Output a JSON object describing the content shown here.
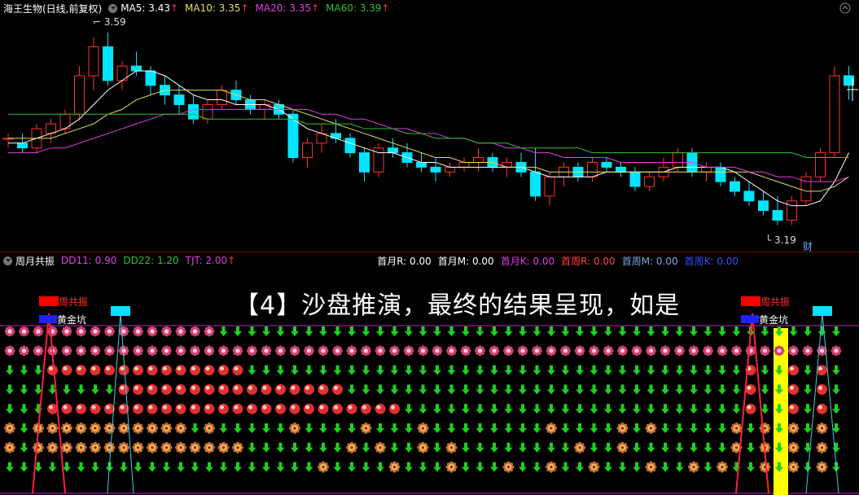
{
  "price_header": {
    "title": "海王生物(日线,前复权)",
    "ma5": "MA5: 3.43",
    "ma10": "MA10: 3.35",
    "ma20": "MA20: 3.35",
    "ma60": "MA60: 3.39",
    "arrow": "↑"
  },
  "price_annot": {
    "high": "3.59",
    "low": "3.19",
    "cai": "财"
  },
  "osc_header": {
    "title": "周月共振",
    "dd11": "DD11: 0.90",
    "dd22": "DD22: 1.20",
    "tjt": "TJT: 2.00",
    "arrow": "↑",
    "r1": "首月R: 0.00",
    "r2": "首月M: 0.00",
    "r3": "首月K: 0.00",
    "r4": "首周R: 0.00",
    "r5": "首周M: 0.00",
    "r6": "首周K: 0.00"
  },
  "overlay": {
    "caption": "【4】沙盘推演，最终的结果呈现，如是"
  },
  "markers": {
    "zhou": "周共振",
    "huang": "黄金坑"
  },
  "colors": {
    "up": "#ff3030",
    "down": "#00e5ff",
    "ma5": "#ffffff",
    "ma10": "#e0e060",
    "ma20": "#e040e0",
    "ma60": "#30c030"
  },
  "chart_data": {
    "type": "candlestick",
    "ylim": [
      3.15,
      3.62
    ],
    "ohlc": [
      [
        3.37,
        3.38,
        3.35,
        3.37
      ],
      [
        3.36,
        3.38,
        3.34,
        3.35
      ],
      [
        3.35,
        3.4,
        3.34,
        3.39
      ],
      [
        3.38,
        3.41,
        3.36,
        3.4
      ],
      [
        3.39,
        3.43,
        3.38,
        3.42
      ],
      [
        3.42,
        3.52,
        3.41,
        3.5
      ],
      [
        3.5,
        3.58,
        3.47,
        3.56
      ],
      [
        3.56,
        3.59,
        3.48,
        3.49
      ],
      [
        3.49,
        3.53,
        3.47,
        3.52
      ],
      [
        3.52,
        3.55,
        3.5,
        3.51
      ],
      [
        3.51,
        3.52,
        3.46,
        3.48
      ],
      [
        3.48,
        3.5,
        3.44,
        3.46
      ],
      [
        3.46,
        3.48,
        3.42,
        3.44
      ],
      [
        3.44,
        3.46,
        3.4,
        3.41
      ],
      [
        3.41,
        3.45,
        3.4,
        3.44
      ],
      [
        3.44,
        3.48,
        3.43,
        3.47
      ],
      [
        3.47,
        3.49,
        3.44,
        3.45
      ],
      [
        3.45,
        3.46,
        3.42,
        3.43
      ],
      [
        3.43,
        3.45,
        3.41,
        3.44
      ],
      [
        3.44,
        3.45,
        3.41,
        3.42
      ],
      [
        3.42,
        3.43,
        3.32,
        3.33
      ],
      [
        3.33,
        3.37,
        3.31,
        3.36
      ],
      [
        3.36,
        3.4,
        3.34,
        3.38
      ],
      [
        3.38,
        3.41,
        3.36,
        3.37
      ],
      [
        3.37,
        3.38,
        3.33,
        3.34
      ],
      [
        3.34,
        3.35,
        3.28,
        3.3
      ],
      [
        3.3,
        3.36,
        3.29,
        3.35
      ],
      [
        3.35,
        3.37,
        3.33,
        3.34
      ],
      [
        3.34,
        3.36,
        3.31,
        3.32
      ],
      [
        3.32,
        3.34,
        3.3,
        3.31
      ],
      [
        3.31,
        3.33,
        3.28,
        3.3
      ],
      [
        3.3,
        3.32,
        3.29,
        3.31
      ],
      [
        3.31,
        3.33,
        3.3,
        3.32
      ],
      [
        3.32,
        3.35,
        3.3,
        3.33
      ],
      [
        3.33,
        3.34,
        3.3,
        3.31
      ],
      [
        3.31,
        3.33,
        3.29,
        3.32
      ],
      [
        3.32,
        3.34,
        3.29,
        3.3
      ],
      [
        3.3,
        3.35,
        3.24,
        3.25
      ],
      [
        3.25,
        3.3,
        3.23,
        3.29
      ],
      [
        3.29,
        3.32,
        3.27,
        3.31
      ],
      [
        3.31,
        3.32,
        3.28,
        3.29
      ],
      [
        3.29,
        3.33,
        3.28,
        3.32
      ],
      [
        3.32,
        3.33,
        3.3,
        3.31
      ],
      [
        3.31,
        3.32,
        3.29,
        3.3
      ],
      [
        3.3,
        3.31,
        3.26,
        3.27
      ],
      [
        3.27,
        3.3,
        3.26,
        3.29
      ],
      [
        3.29,
        3.33,
        3.28,
        3.31
      ],
      [
        3.31,
        3.35,
        3.3,
        3.34
      ],
      [
        3.34,
        3.35,
        3.29,
        3.3
      ],
      [
        3.3,
        3.32,
        3.28,
        3.31
      ],
      [
        3.31,
        3.32,
        3.27,
        3.28
      ],
      [
        3.28,
        3.29,
        3.25,
        3.26
      ],
      [
        3.26,
        3.28,
        3.23,
        3.24
      ],
      [
        3.24,
        3.26,
        3.21,
        3.22
      ],
      [
        3.22,
        3.25,
        3.19,
        3.2
      ],
      [
        3.2,
        3.25,
        3.19,
        3.24
      ],
      [
        3.24,
        3.3,
        3.23,
        3.29
      ],
      [
        3.29,
        3.35,
        3.28,
        3.34
      ],
      [
        3.34,
        3.52,
        3.33,
        3.5
      ],
      [
        3.5,
        3.52,
        3.45,
        3.48
      ]
    ],
    "ma5": [
      3.36,
      3.36,
      3.37,
      3.38,
      3.39,
      3.41,
      3.44,
      3.47,
      3.49,
      3.51,
      3.51,
      3.5,
      3.48,
      3.46,
      3.45,
      3.45,
      3.44,
      3.44,
      3.44,
      3.43,
      3.41,
      3.39,
      3.38,
      3.37,
      3.36,
      3.35,
      3.34,
      3.34,
      3.33,
      3.32,
      3.32,
      3.31,
      3.31,
      3.31,
      3.31,
      3.31,
      3.31,
      3.3,
      3.29,
      3.29,
      3.29,
      3.29,
      3.3,
      3.3,
      3.3,
      3.3,
      3.3,
      3.31,
      3.31,
      3.31,
      3.31,
      3.3,
      3.28,
      3.26,
      3.24,
      3.23,
      3.23,
      3.24,
      3.28,
      3.34
    ],
    "ma10": [
      3.37,
      3.37,
      3.37,
      3.37,
      3.38,
      3.39,
      3.4,
      3.42,
      3.43,
      3.45,
      3.46,
      3.47,
      3.47,
      3.47,
      3.47,
      3.47,
      3.46,
      3.45,
      3.45,
      3.44,
      3.43,
      3.42,
      3.41,
      3.4,
      3.39,
      3.38,
      3.37,
      3.36,
      3.35,
      3.34,
      3.33,
      3.33,
      3.32,
      3.32,
      3.32,
      3.31,
      3.31,
      3.31,
      3.3,
      3.3,
      3.3,
      3.3,
      3.3,
      3.3,
      3.3,
      3.3,
      3.3,
      3.3,
      3.3,
      3.3,
      3.3,
      3.3,
      3.3,
      3.29,
      3.28,
      3.27,
      3.26,
      3.26,
      3.27,
      3.29
    ],
    "ma20": [
      3.34,
      3.34,
      3.34,
      3.35,
      3.35,
      3.36,
      3.37,
      3.38,
      3.39,
      3.4,
      3.41,
      3.42,
      3.42,
      3.43,
      3.43,
      3.43,
      3.43,
      3.43,
      3.43,
      3.43,
      3.43,
      3.43,
      3.42,
      3.42,
      3.41,
      3.41,
      3.4,
      3.39,
      3.39,
      3.38,
      3.38,
      3.37,
      3.37,
      3.36,
      3.36,
      3.35,
      3.35,
      3.34,
      3.34,
      3.33,
      3.33,
      3.33,
      3.33,
      3.32,
      3.32,
      3.32,
      3.32,
      3.32,
      3.32,
      3.31,
      3.31,
      3.31,
      3.3,
      3.3,
      3.29,
      3.29,
      3.28,
      3.28,
      3.28,
      3.29
    ],
    "ma60": [
      3.42,
      3.42,
      3.42,
      3.42,
      3.42,
      3.42,
      3.42,
      3.42,
      3.42,
      3.42,
      3.42,
      3.42,
      3.42,
      3.42,
      3.41,
      3.41,
      3.41,
      3.41,
      3.41,
      3.41,
      3.41,
      3.4,
      3.4,
      3.4,
      3.4,
      3.39,
      3.39,
      3.39,
      3.38,
      3.38,
      3.37,
      3.37,
      3.37,
      3.36,
      3.36,
      3.36,
      3.35,
      3.35,
      3.35,
      3.35,
      3.35,
      3.34,
      3.34,
      3.34,
      3.34,
      3.34,
      3.34,
      3.34,
      3.34,
      3.34,
      3.34,
      3.34,
      3.34,
      3.34,
      3.34,
      3.34,
      3.33,
      3.33,
      3.33,
      3.33
    ]
  },
  "grid": {
    "columns": 59,
    "rows": [
      {
        "sym": "flower",
        "stop": 15
      },
      {
        "sym": "flower",
        "stop": 59
      },
      {
        "sym": "ball",
        "from": 3,
        "stop": 17,
        "ball2": [
          52,
          55,
          57,
          59
        ]
      },
      {
        "sym": "ball",
        "from": 8,
        "stop": 24,
        "ball2": [
          52,
          55,
          57,
          59
        ]
      },
      {
        "sym": "ball",
        "from": 3,
        "stop": 28,
        "ball2": [
          52,
          55,
          57,
          59
        ]
      },
      {
        "sym": "cog",
        "stop": 13,
        "cog2": [
          14,
          20,
          25,
          29,
          38,
          43,
          45,
          51,
          53,
          55,
          57,
          59
        ]
      },
      {
        "sym": "cog",
        "stop": 17,
        "cog2": [
          24,
          26,
          29,
          31,
          40,
          43,
          51,
          53,
          55,
          57,
          59
        ]
      },
      {
        "sym": "cog",
        "stop": 0,
        "cog2": [
          22,
          27,
          31,
          35,
          38,
          41,
          45,
          48,
          50,
          53,
          55,
          57,
          59
        ]
      }
    ]
  }
}
